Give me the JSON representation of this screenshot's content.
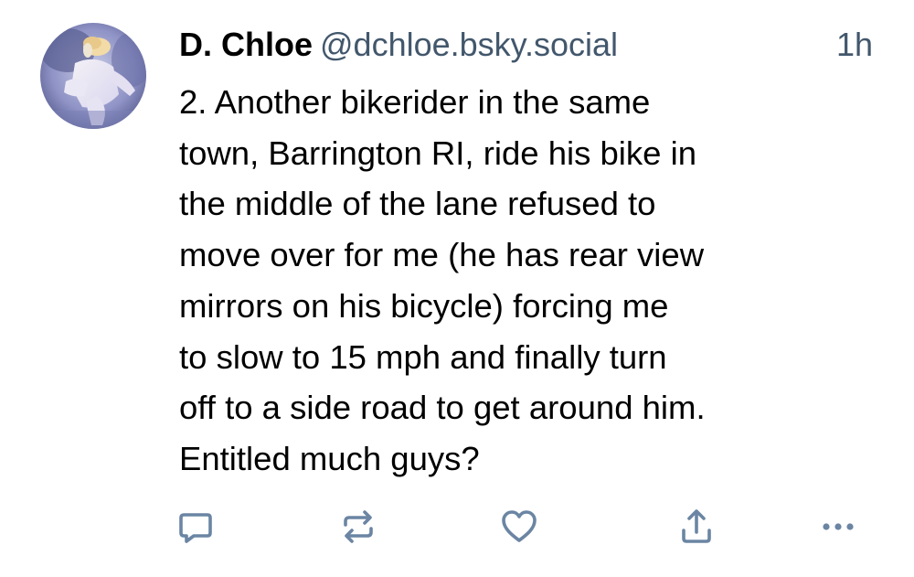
{
  "post": {
    "author": {
      "display_name": "D. Chloe",
      "handle": "@dchloe.bsky.social"
    },
    "timestamp": "1h",
    "text_lines": [
      "2. Another bikerider in the same",
      "town, Barrington RI, ride his bike in",
      "the middle of the lane refused to",
      "move over for me (he has rear view",
      "mirrors on his bicycle) forcing me",
      "to slow to 15 mph and finally turn",
      "off to a side road to get around him.",
      "Entitled much guys?"
    ]
  },
  "actions": [
    {
      "name": "reply",
      "icon": "reply-icon"
    },
    {
      "name": "repost",
      "icon": "repost-icon"
    },
    {
      "name": "like",
      "icon": "heart-icon"
    },
    {
      "name": "share",
      "icon": "share-icon"
    },
    {
      "name": "more",
      "icon": "more-icon"
    }
  ],
  "colors": {
    "text": "#000000",
    "muted": "#42576c",
    "icon": "#6b85a3",
    "background": "#ffffff"
  }
}
